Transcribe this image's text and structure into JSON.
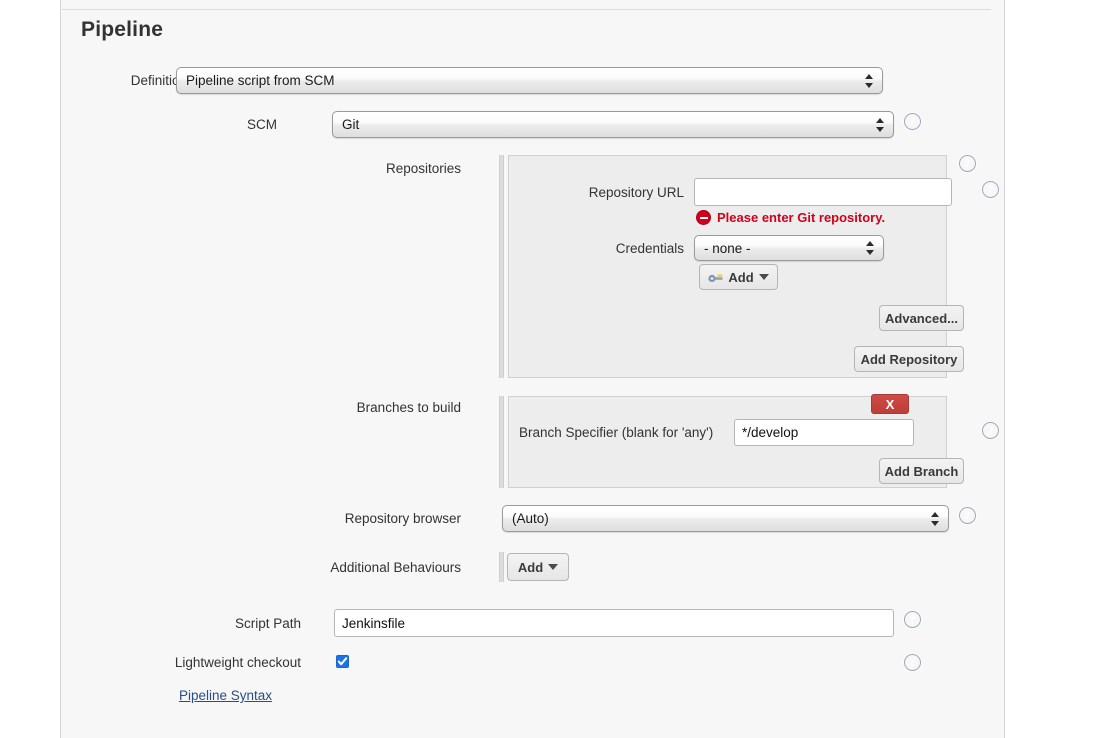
{
  "section": {
    "title": "Pipeline"
  },
  "definition": {
    "label": "Definition",
    "value": "Pipeline script from SCM"
  },
  "scm": {
    "label": "SCM",
    "value": "Git",
    "help": "?"
  },
  "repositories": {
    "label": "Repositories",
    "help": "?",
    "repository_url": {
      "label": "Repository URL",
      "value": "",
      "placeholder": "",
      "help": "?"
    },
    "error": {
      "text": "Please enter Git repository.",
      "icon": "error-circle-icon",
      "color": "#d0021b"
    },
    "credentials": {
      "label": "Credentials",
      "value": "- none -"
    },
    "add_credentials_button": {
      "label": "Add",
      "icon": "key-icon",
      "caret": "chevron-down-icon"
    },
    "advanced_button": "Advanced...",
    "add_repository_button": "Add Repository"
  },
  "branches": {
    "label": "Branches to build",
    "delete_button": "X",
    "branch_specifier": {
      "label": "Branch Specifier (blank for 'any')",
      "value": "*/develop",
      "help": "?"
    },
    "add_branch_button": "Add Branch"
  },
  "repository_browser": {
    "label": "Repository browser",
    "value": "(Auto)",
    "help": "?"
  },
  "additional_behaviours": {
    "label": "Additional Behaviours",
    "add_button": "Add",
    "caret": "chevron-down-icon"
  },
  "script_path": {
    "label": "Script Path",
    "value": "Jenkinsfile",
    "help": "?"
  },
  "lightweight_checkout": {
    "label": "Lightweight checkout",
    "checked": true,
    "help": "?"
  },
  "pipeline_syntax_link": "Pipeline Syntax",
  "colors": {
    "panel_bg": "#f7f7f7",
    "inner_bg": "#ededed",
    "error_red": "#d0021b",
    "delete_red": "#c4403a",
    "help_blue": "#3a5382",
    "link_blue": "#294e87",
    "checkbox_blue": "#1a73e8"
  }
}
